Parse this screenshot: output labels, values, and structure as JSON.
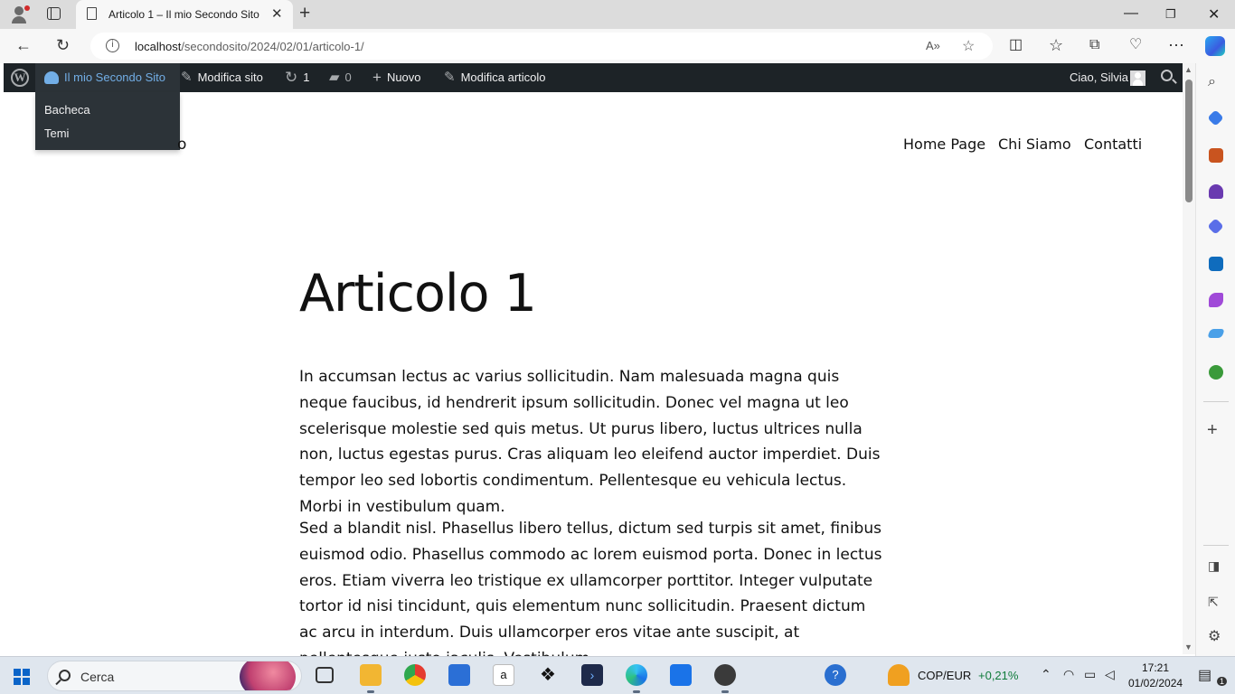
{
  "browser": {
    "tab_title": "Articolo 1 – Il mio Secondo Sito",
    "url_host": "localhost",
    "url_path": "/secondosito/2024/02/01/articolo-1/",
    "icons": {
      "profile": "profile-icon",
      "tab_actions": "tab-actions-icon",
      "new_tab": "plus-icon",
      "back": "back-arrow-icon",
      "refresh": "refresh-icon",
      "read_aloud": "read-aloud-icon",
      "favorite": "star-icon",
      "split_screen": "split-screen-icon",
      "favorites": "favorites-icon",
      "collections": "collections-icon",
      "browser_essentials": "heart-pulse-icon",
      "more": "more-icon",
      "copilot": "copilot-icon"
    }
  },
  "adminbar": {
    "site_name": "Il mio Secondo Sito",
    "edit_site": "Modifica sito",
    "updates_count": "1",
    "comments_count": "0",
    "new": "Nuovo",
    "edit_post": "Modifica articolo",
    "greeting": "Ciao, Silvia",
    "site_menu": [
      "Bacheca",
      "Temi"
    ],
    "accent_color": "#72aee6",
    "bg_color": "#1d2327"
  },
  "page": {
    "site_title_fragment": "o",
    "nav": [
      "Home Page",
      "Chi Siamo",
      "Contatti"
    ],
    "post_title": "Articolo 1",
    "paragraphs": [
      "In accumsan lectus ac varius sollicitudin. Nam malesuada magna quis neque faucibus, id hendrerit ipsum sollicitudin. Donec vel magna ut leo scelerisque molestie sed quis metus. Ut purus libero, luctus ultrices nulla non, luctus egestas purus. Cras aliquam leo eleifend auctor imperdiet. Duis tempor leo sed lobortis condimentum. Pellentesque eu vehicula lectus. Morbi in vestibulum quam.",
      "Sed a blandit nisl. Phasellus libero tellus, dictum sed turpis sit amet, finibus euismod odio. Phasellus commodo ac lorem euismod porta. Donec in lectus eros. Etiam viverra leo tristique ex ullamcorper porttitor. Integer vulputate tortor id nisi tincidunt, quis elementum nunc sollicitudin. Praesent dictum ac arcu in interdum. Duis ullamcorper eros vitae ante suscipit, at pellentesque justo iaculis. Vestibulum"
    ]
  },
  "taskbar": {
    "search_placeholder": "Cerca",
    "widget_label": "COP/EUR",
    "widget_value": "+0,21%",
    "time": "17:21",
    "date": "01/02/2024",
    "notification_count": "1",
    "widget_value_color": "#0f7b3a"
  }
}
